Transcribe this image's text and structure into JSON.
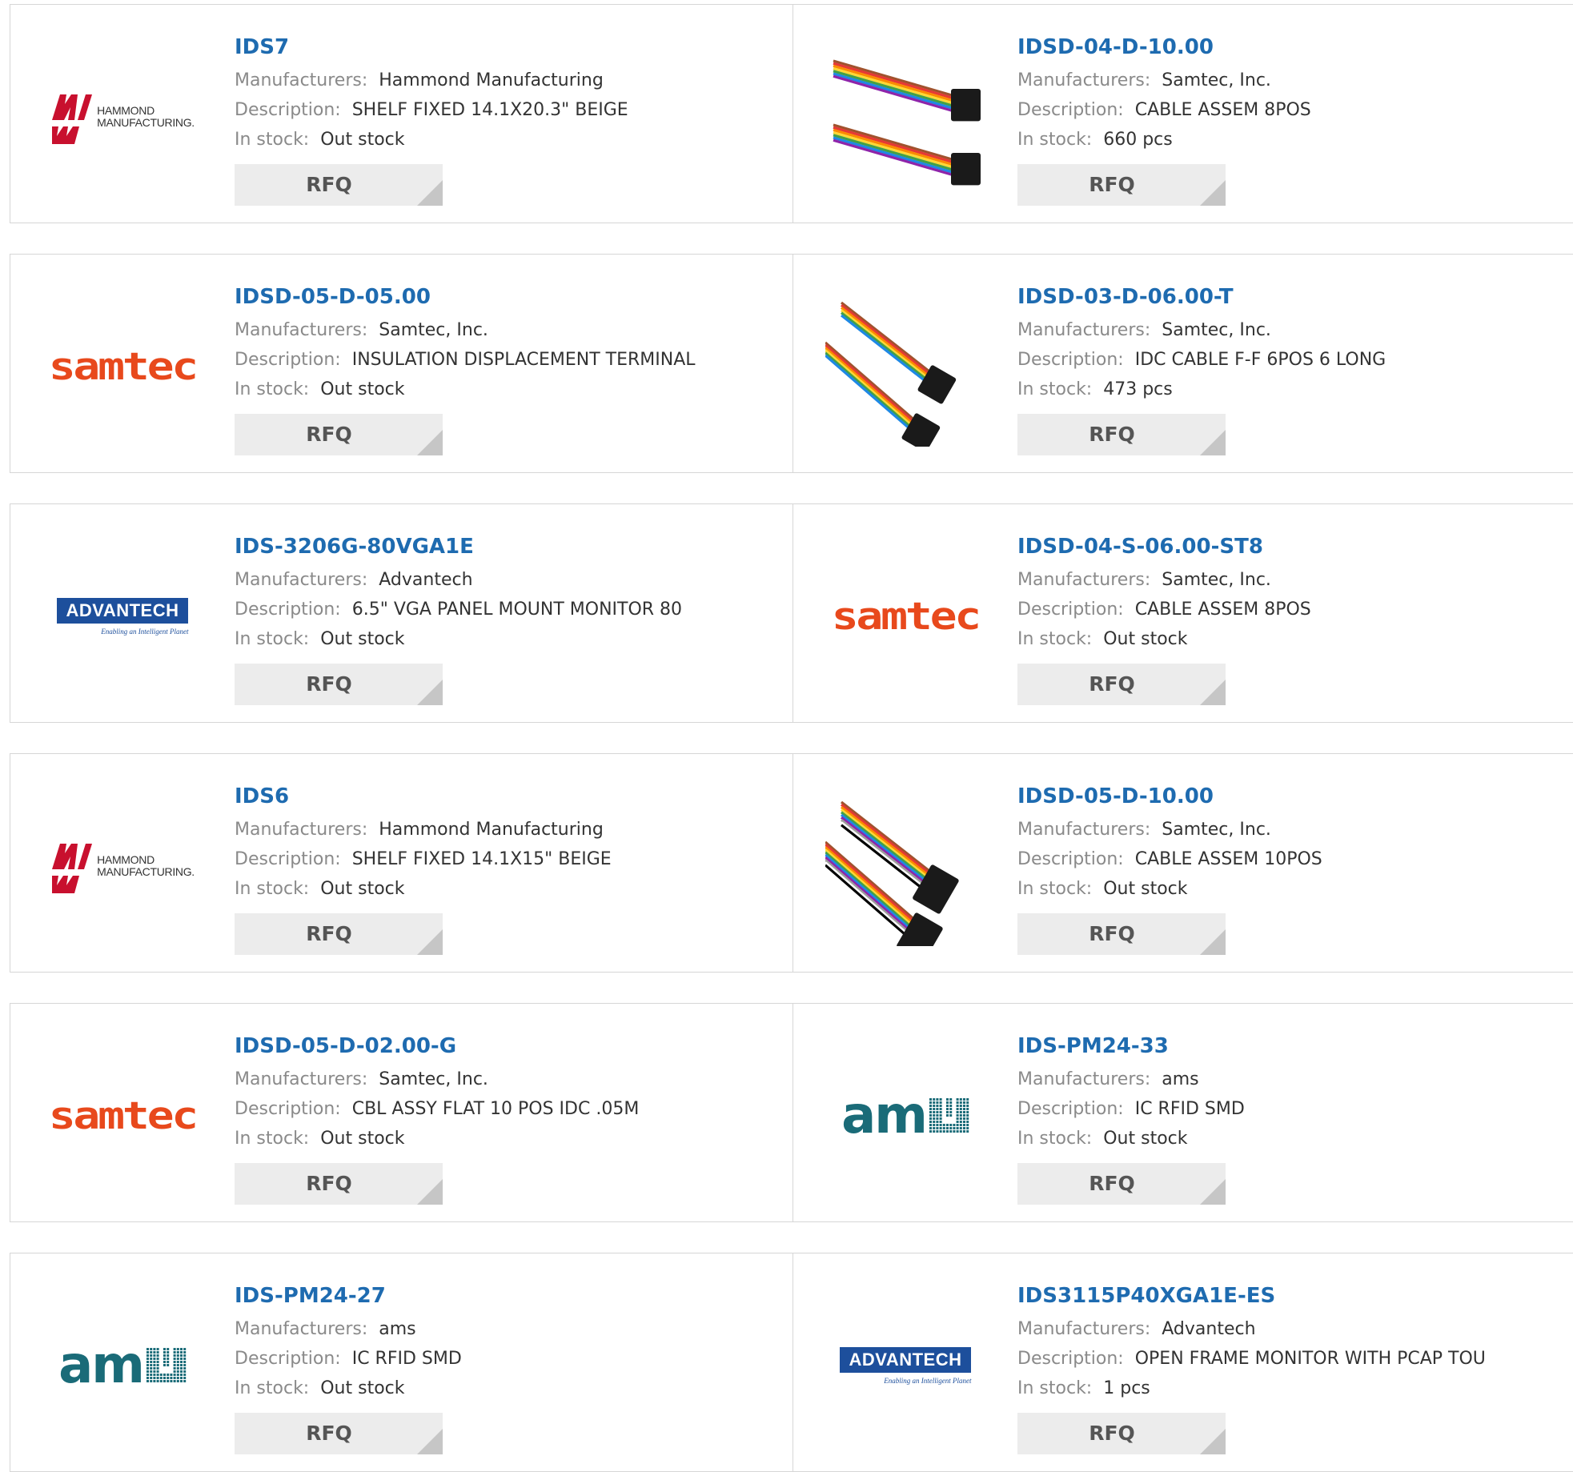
{
  "labels": {
    "manufacturers": "Manufacturers:",
    "description": "Description:",
    "stock": "In stock:",
    "rfq": "RFQ"
  },
  "products": [
    {
      "part": "IDS7",
      "manufacturer": "Hammond Manufacturing",
      "description": "SHELF FIXED 14.1X20.3\" BEIGE",
      "stock": "Out stock",
      "image": "hammond-logo",
      "logo_text": [
        "HAMMOND",
        "MANUFACTURING."
      ]
    },
    {
      "part": "IDSD-04-D-10.00",
      "manufacturer": "Samtec, Inc.",
      "description": "CABLE ASSEM 8POS",
      "stock": "660 pcs",
      "image": "ribbon-cable-photo"
    },
    {
      "part": "IDSD-05-D-05.00",
      "manufacturer": "Samtec, Inc.",
      "description": "INSULATION DISPLACEMENT TERMINAL",
      "stock": "Out stock",
      "image": "samtec-logo",
      "logo_text": [
        "samtec"
      ]
    },
    {
      "part": "IDSD-03-D-06.00-T",
      "manufacturer": "Samtec, Inc.",
      "description": "IDC CABLE F-F 6POS 6 LONG",
      "stock": "473 pcs",
      "image": "ribbon-cable-photo"
    },
    {
      "part": "IDS-3206G-80VGA1E",
      "manufacturer": "Advantech",
      "description": "6.5\" VGA PANEL MOUNT MONITOR 80",
      "stock": "Out stock",
      "image": "advantech-logo",
      "logo_text": [
        "ADVANTECH",
        "Enabling an Intelligent Planet"
      ]
    },
    {
      "part": "IDSD-04-S-06.00-ST8",
      "manufacturer": "Samtec, Inc.",
      "description": "CABLE ASSEM 8POS",
      "stock": "Out stock",
      "image": "samtec-logo",
      "logo_text": [
        "samtec"
      ]
    },
    {
      "part": "IDS6",
      "manufacturer": "Hammond Manufacturing",
      "description": "SHELF FIXED 14.1X15\" BEIGE",
      "stock": "Out stock",
      "image": "hammond-logo",
      "logo_text": [
        "HAMMOND",
        "MANUFACTURING."
      ]
    },
    {
      "part": "IDSD-05-D-10.00",
      "manufacturer": "Samtec, Inc.",
      "description": "CABLE ASSEM 10POS",
      "stock": "Out stock",
      "image": "ribbon-cable-photo"
    },
    {
      "part": "IDSD-05-D-02.00-G",
      "manufacturer": "Samtec, Inc.",
      "description": "CBL ASSY FLAT 10 POS IDC .05M",
      "stock": "Out stock",
      "image": "samtec-logo",
      "logo_text": [
        "samtec"
      ]
    },
    {
      "part": "IDS-PM24-33",
      "manufacturer": "ams",
      "description": "IC RFID SMD",
      "stock": "Out stock",
      "image": "ams-logo",
      "logo_text": [
        "am"
      ]
    },
    {
      "part": "IDS-PM24-27",
      "manufacturer": "ams",
      "description": "IC RFID SMD",
      "stock": "Out stock",
      "image": "ams-logo",
      "logo_text": [
        "am"
      ]
    },
    {
      "part": "IDS3115P40XGA1E-ES",
      "manufacturer": "Advantech",
      "description": "OPEN FRAME MONITOR WITH PCAP TOU",
      "stock": "1 pcs",
      "image": "advantech-logo",
      "logo_text": [
        "ADVANTECH",
        "Enabling an Intelligent Planet"
      ]
    }
  ],
  "colors": {
    "part_link": "#1e6bb0",
    "label": "#8a8a8a",
    "value": "#333333",
    "border": "#d6d6d6",
    "button_bg": "#ececec",
    "samtec": "#e8491c",
    "advantech": "#1d4f9c",
    "ams": "#1a6b78",
    "hammond": "#c8102e"
  }
}
